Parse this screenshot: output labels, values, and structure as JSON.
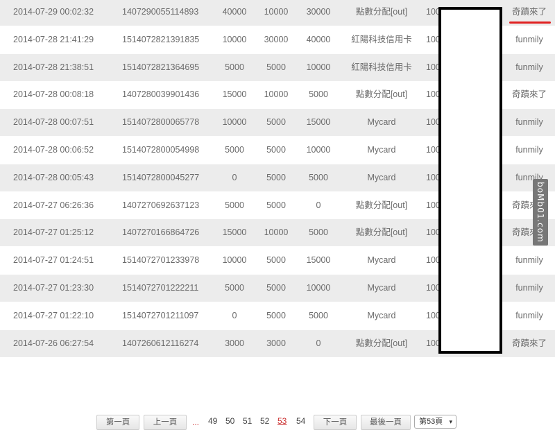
{
  "rows": [
    {
      "date": "2014-07-29 00:02:32",
      "id": "1407290055114893",
      "a": "40000",
      "b": "10000",
      "c": "30000",
      "type": "點數分配[out]",
      "trunc": "100",
      "user": "奇蹟來了"
    },
    {
      "date": "2014-07-28 21:41:29",
      "id": "1514072821391835",
      "a": "10000",
      "b": "30000",
      "c": "40000",
      "type": "紅陽科技信用卡",
      "trunc": "100",
      "user": "funmily"
    },
    {
      "date": "2014-07-28 21:38:51",
      "id": "1514072821364695",
      "a": "5000",
      "b": "5000",
      "c": "10000",
      "type": "紅陽科技信用卡",
      "trunc": "100",
      "user": "funmily"
    },
    {
      "date": "2014-07-28 00:08:18",
      "id": "1407280039901436",
      "a": "15000",
      "b": "10000",
      "c": "5000",
      "type": "點數分配[out]",
      "trunc": "100",
      "user": "奇蹟來了"
    },
    {
      "date": "2014-07-28 00:07:51",
      "id": "1514072800065778",
      "a": "10000",
      "b": "5000",
      "c": "15000",
      "type": "Mycard",
      "trunc": "100",
      "user": "funmily"
    },
    {
      "date": "2014-07-28 00:06:52",
      "id": "1514072800054998",
      "a": "5000",
      "b": "5000",
      "c": "10000",
      "type": "Mycard",
      "trunc": "100",
      "user": "funmily"
    },
    {
      "date": "2014-07-28 00:05:43",
      "id": "1514072800045277",
      "a": "0",
      "b": "5000",
      "c": "5000",
      "type": "Mycard",
      "trunc": "100",
      "user": "funmily"
    },
    {
      "date": "2014-07-27 06:26:36",
      "id": "1407270692637123",
      "a": "5000",
      "b": "5000",
      "c": "0",
      "type": "點數分配[out]",
      "trunc": "100",
      "user": "奇蹟來了"
    },
    {
      "date": "2014-07-27 01:25:12",
      "id": "1407270166864726",
      "a": "15000",
      "b": "10000",
      "c": "5000",
      "type": "點數分配[out]",
      "trunc": "100",
      "user": "奇蹟來了"
    },
    {
      "date": "2014-07-27 01:24:51",
      "id": "1514072701233978",
      "a": "10000",
      "b": "5000",
      "c": "15000",
      "type": "Mycard",
      "trunc": "100",
      "user": "funmily"
    },
    {
      "date": "2014-07-27 01:23:30",
      "id": "1514072701222211",
      "a": "5000",
      "b": "5000",
      "c": "10000",
      "type": "Mycard",
      "trunc": "100",
      "user": "funmily"
    },
    {
      "date": "2014-07-27 01:22:10",
      "id": "1514072701211097",
      "a": "0",
      "b": "5000",
      "c": "5000",
      "type": "Mycard",
      "trunc": "100",
      "user": "funmily"
    },
    {
      "date": "2014-07-26 06:27:54",
      "id": "1407260612116274",
      "a": "3000",
      "b": "3000",
      "c": "0",
      "type": "點數分配[out]",
      "trunc": "100",
      "user": "奇蹟來了"
    }
  ],
  "pager": {
    "first": "第一頁",
    "prev": "上一頁",
    "dots": "...",
    "pages": [
      "49",
      "50",
      "51",
      "52",
      "53",
      "54"
    ],
    "current": "53",
    "next": "下一頁",
    "last": "最後一頁",
    "select_value": "第53頁"
  },
  "watermark": "boMb01.com",
  "colors": {
    "row_even": "#ececec",
    "row_odd": "#ffffff",
    "text": "#6b6b6b",
    "accent_red": "#e02020"
  }
}
